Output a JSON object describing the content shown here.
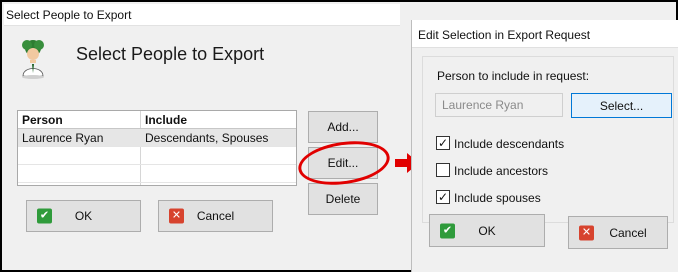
{
  "left_dialog": {
    "window_title": "Select People to Export",
    "header_title": "Select People to Export",
    "table": {
      "columns": [
        "Person",
        "Include"
      ],
      "rows": [
        {
          "person": "Laurence Ryan",
          "include": "Descendants, Spouses"
        }
      ]
    },
    "buttons": {
      "add": "Add...",
      "edit": "Edit...",
      "delete": "Delete",
      "ok": "OK",
      "cancel": "Cancel"
    }
  },
  "right_dialog": {
    "window_title": "Edit Selection in Export Request",
    "person_label": "Person to include in request:",
    "person_value": "Laurence Ryan",
    "select_button": "Select...",
    "options": [
      {
        "label": "Include descendants",
        "checked": true
      },
      {
        "label": "Include ancestors",
        "checked": false
      },
      {
        "label": "Include spouses",
        "checked": true
      }
    ],
    "buttons": {
      "ok": "OK",
      "cancel": "Cancel"
    }
  },
  "icons": {
    "ok": "checkmark-icon",
    "cancel": "x-icon",
    "avatar": "person-avatar-icon",
    "arrow": "red-arrow-icon"
  },
  "colors": {
    "highlight": "#e10000",
    "ok_green": "#2f9b3b",
    "cancel_red": "#d7432e",
    "focus_blue": "#0078d7"
  }
}
